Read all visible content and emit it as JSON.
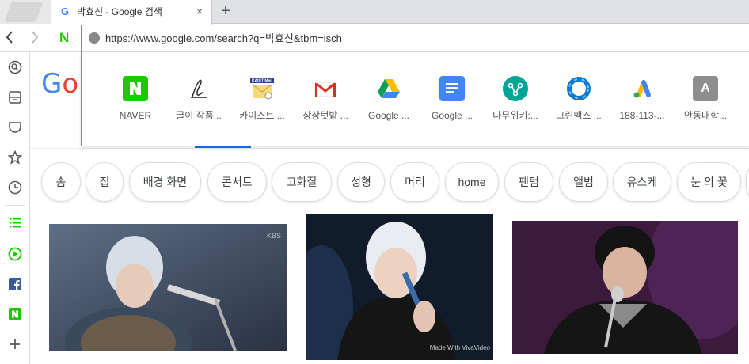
{
  "browser": {
    "tab": {
      "favicon": "G",
      "title": "박효신 - Google 검색",
      "close": "×"
    },
    "new_tab": "+",
    "nav": {
      "back": "‹",
      "forward": "›",
      "naver_badge": "N"
    },
    "address": {
      "url": "https://www.google.com/search?q=박효신&tbm=isch"
    }
  },
  "sidebar": {
    "items": [
      {
        "icon": "search-circle-icon"
      },
      {
        "icon": "tray-icon"
      },
      {
        "icon": "pocket-icon"
      },
      {
        "icon": "star-icon"
      },
      {
        "icon": "history-icon"
      },
      {
        "icon": "list-icon"
      },
      {
        "icon": "play-icon"
      },
      {
        "icon": "facebook-icon"
      },
      {
        "icon": "naver-icon"
      },
      {
        "icon": "plus-icon"
      }
    ]
  },
  "page": {
    "logo_part1": "G",
    "logo_part2": "o"
  },
  "speed_dial": [
    {
      "label": "NAVER",
      "icon": "naver-icon",
      "glyph": "N",
      "color": "#1ec800"
    },
    {
      "label": "글이 작품...",
      "icon": "signature-icon",
      "glyph": "",
      "color": "#ffffff"
    },
    {
      "label": "카이스트 ...",
      "icon": "kaist-mail-icon",
      "glyph": "KAIST Mail",
      "color": "#f6d97a"
    },
    {
      "label": "상상텃밭 ...",
      "icon": "gmail-icon",
      "glyph": "M",
      "color": "#ffffff"
    },
    {
      "label": "Google ...",
      "icon": "google-drive-icon",
      "glyph": "",
      "color": "#ffffff"
    },
    {
      "label": "Google ...",
      "icon": "google-docs-icon",
      "glyph": "",
      "color": "#4285f4"
    },
    {
      "label": "나무위키:...",
      "icon": "namuwiki-icon",
      "glyph": "",
      "color": "#00a495"
    },
    {
      "label": "그린맥스 ...",
      "icon": "greenmax-icon",
      "glyph": "",
      "color": "#ffffff"
    },
    {
      "label": "188-113-...",
      "icon": "google-ads-icon",
      "glyph": "",
      "color": "#ffffff"
    },
    {
      "label": "안동대학...",
      "icon": "letter-a-icon",
      "glyph": "A",
      "color": "#8e8e8e"
    }
  ],
  "chips": [
    {
      "label": "솜"
    },
    {
      "label": "집"
    },
    {
      "label": "배경 화면"
    },
    {
      "label": "콘서트"
    },
    {
      "label": "고화질"
    },
    {
      "label": "성형"
    },
    {
      "label": "머리"
    },
    {
      "label": "home"
    },
    {
      "label": "팬텀"
    },
    {
      "label": "앨범"
    },
    {
      "label": "유스케"
    },
    {
      "label": "눈 의 꽃"
    }
  ],
  "images": [
    {
      "watermark": "KBS"
    },
    {
      "watermark": "Made With VivaVideo"
    },
    {
      "watermark": ""
    }
  ]
}
